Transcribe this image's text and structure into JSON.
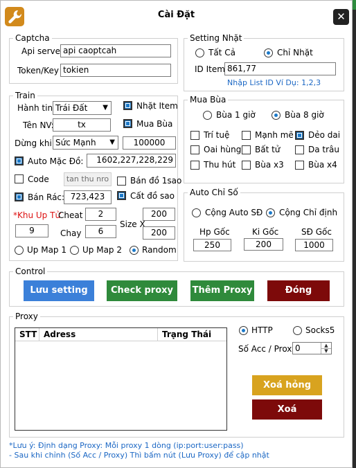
{
  "window": {
    "title": "Cài Đặt",
    "close_label": "✕"
  },
  "captcha": {
    "legend": "Captcha",
    "api_server_label": "Api server",
    "api_server_value": "api caoptcah",
    "token_label": "Token/Key",
    "token_value": "tokien"
  },
  "setting_nhat": {
    "legend": "Setting Nhặt",
    "radio_all": "Tất Cả",
    "radio_nhat": "Chỉ Nhặt",
    "id_item_label": "ID Item",
    "id_item_value": "861,77",
    "hint": "Nhập List ID Ví Dụ: 1,2,3"
  },
  "train": {
    "legend": "Train",
    "hanh_tinh_label": "Hành tinh:",
    "hanh_tinh_value": "Trái Đất",
    "nhat_item": "Nhặt Item",
    "ten_nv_label": "Tên NV:",
    "ten_nv_value": "tx",
    "mua_bua": "Mua Bùa",
    "dung_khi_label": "Dừng khi:",
    "dung_khi_value": "Sức Mạnh",
    "dung_khi_amount": "100000",
    "auto_mac_do": "Auto Mặc Đồ:",
    "auto_mac_do_value": "1602,227,228,229",
    "code": "Code",
    "code_placeholder": "tan thu nro",
    "ban_do_1sao": "Bán đồ 1sao",
    "ban_rac": "Bán Rác:",
    "ban_rac_value": "723,423",
    "cat_do_sao": "Cất đồ sao",
    "khu_up_tu": "*Khu Up Tử",
    "khu_value": "9",
    "cheat_label": "Cheat",
    "cheat_value": "2",
    "chay_label": "Chay",
    "chay_value": "6",
    "size_x_label": "Size X",
    "size_a": "200",
    "size_b": "200",
    "up_map_1": "Up Map 1",
    "up_map_2": "Up Map 2",
    "random": "Random"
  },
  "mua_bua": {
    "legend": "Mua Bùa",
    "bua_1": "Bùa 1 giờ",
    "bua_8": "Bùa 8 giờ",
    "items": [
      "Trí tuệ",
      "Mạnh mẽ",
      "Dẻo dai",
      "Oai hùng",
      "Bất tử",
      "Da trâu",
      "Thu hút",
      "Bùa x3",
      "Bùa x4"
    ]
  },
  "auto_chi_so": {
    "legend": "Auto Chỉ Số",
    "cong_auto": "Cộng Auto SĐ",
    "cong_chi_dinh": "Cộng Chỉ định",
    "hp_label": "Hp Gốc",
    "hp_value": "250",
    "ki_label": "Ki Gốc",
    "ki_value": "200",
    "sd_label": "SĐ Gốc",
    "sd_value": "1000"
  },
  "control": {
    "legend": "Control",
    "luu": "Lưu setting",
    "check_proxy": "Check proxy",
    "them_proxy": "Thêm Proxy",
    "dong": "Đóng"
  },
  "proxy": {
    "legend": "Proxy",
    "columns": [
      "STT",
      "Adress",
      "Trạng Thái"
    ],
    "http": "HTTP",
    "socks5": "Socks5",
    "so_acc_label": "Số Acc / Proxy",
    "so_acc_value": "0",
    "xoa_hong": "Xoá hỏng",
    "xoa": "Xoá"
  },
  "notes": {
    "line1": "*Lưu ý:  Định dạng Proxy: Mỗi proxy 1 dòng (ip:port:user:pass)",
    "line2": "- Sau khi chỉnh (Số Acc / Proxy) Thì bấm nút (Lưu Proxy) để cập nhật"
  },
  "colors": {
    "accent_blue": "#1b79c9",
    "btn_blue": "#3b80d9",
    "btn_green": "#2f8a3b",
    "btn_darkred": "#7d0a0a",
    "btn_gold": "#d8a31f",
    "link_blue": "#1b67c4",
    "icon_orange": "#d28a1c"
  }
}
